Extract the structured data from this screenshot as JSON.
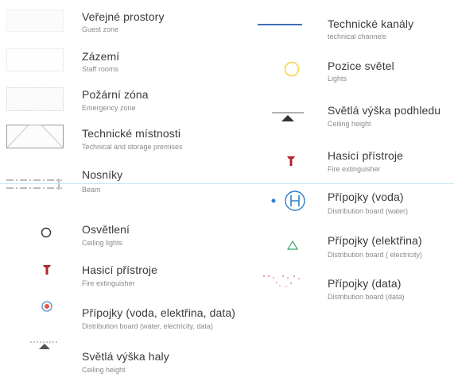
{
  "legend_left": [
    {
      "cz": "Veřejné prostory",
      "en": "Guest zone",
      "symbol": "guest-zone-swatch"
    },
    {
      "cz": "Zázemí",
      "en": "Staff rooms",
      "symbol": "staff-rooms-swatch"
    },
    {
      "cz": "Požární zóna",
      "en": "Emergency zone",
      "symbol": "emergency-zone-swatch"
    },
    {
      "cz": "Technické místnosti",
      "en": "Technical and storage premises",
      "symbol": "technical-premises-swatch"
    },
    {
      "cz": "Nosníky",
      "en": "Beam",
      "symbol": "beam-dashed-line"
    },
    {
      "cz": "Osvětlení",
      "en": "Ceiling lights",
      "symbol": "circle-icon"
    },
    {
      "cz": "Hasicí přístroje",
      "en": "Fire extinguisher",
      "symbol": "fire-extinguisher-icon"
    },
    {
      "cz": "Přípojky (voda, elektřina, data)",
      "en": "Distribution board (water, electricity, data)",
      "symbol": "distribution-board-icon"
    },
    {
      "cz": "Světlá výška haly",
      "en": "Ceiling height",
      "symbol": "ceiling-height-icon"
    }
  ],
  "legend_right": [
    {
      "cz": "Technické kanály",
      "en": "technical channels",
      "symbol": "blue-line"
    },
    {
      "cz": "Pozice světel",
      "en": "Lights",
      "symbol": "yellow-circle-icon"
    },
    {
      "cz": "Světlá výška podhledu",
      "en": "Ceiling height",
      "symbol": "ceiling-height-icon"
    },
    {
      "cz": "Hasicí přístroje",
      "en": "Fire extinguisher",
      "symbol": "fire-extinguisher-icon"
    },
    {
      "cz": "Přípojky (voda)",
      "en": "Distribution board (water)",
      "symbol": "h-circle-icon"
    },
    {
      "cz": "Přípojky (elektřina)",
      "en": "Distribution board ( electricity)",
      "symbol": "green-triangle-icon"
    },
    {
      "cz": "Přípojky (data)",
      "en": "Distribution board (data)",
      "symbol": "data-dots-icon"
    }
  ],
  "colors": {
    "technical_channel": "#3f6fb5",
    "light_position": "#f2d64a",
    "fire_extinguisher": "#b3242c",
    "water_board": "#2f7fd0",
    "electricity_board": "#3aa36a",
    "data_board": "#e79a9a",
    "divider": "#bfe8f4"
  }
}
